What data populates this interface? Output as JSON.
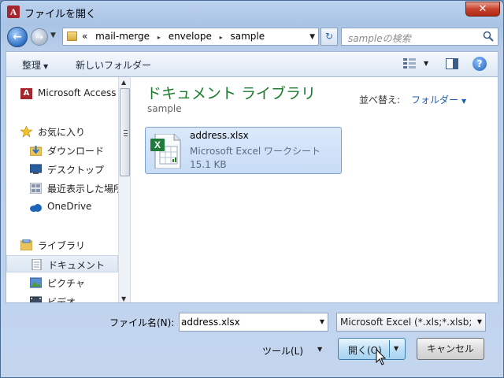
{
  "window": {
    "title": "ファイルを開く",
    "app_icon_letter": "A",
    "close_glyph": "✕"
  },
  "nav": {
    "back_glyph": "←",
    "forward_glyph": "→",
    "address": {
      "prefix": "«",
      "crumbs": [
        "mail-merge",
        "envelope",
        "sample"
      ],
      "separator": "▸"
    },
    "refresh_glyph": "↻",
    "search_placeholder": "sampleの検索"
  },
  "toolbar": {
    "organize": "整理",
    "new_folder": "新しいフォルダー"
  },
  "sidebar": {
    "items": [
      {
        "label": "Microsoft Access",
        "icon": "access-icon"
      },
      {
        "label": "お気に入り",
        "icon": "favorites-star-icon"
      },
      {
        "label": "ダウンロード",
        "icon": "downloads-icon"
      },
      {
        "label": "デスクトップ",
        "icon": "desktop-icon"
      },
      {
        "label": "最近表示した場所",
        "icon": "recent-places-icon"
      },
      {
        "label": "OneDrive",
        "icon": "onedrive-cloud-icon"
      },
      {
        "label": "ライブラリ",
        "icon": "libraries-icon"
      },
      {
        "label": "ドキュメント",
        "icon": "documents-icon",
        "selected": true
      },
      {
        "label": "ピクチャ",
        "icon": "pictures-icon"
      },
      {
        "label": "ビデオ",
        "icon": "videos-icon"
      }
    ]
  },
  "content": {
    "library_title": "ドキュメント ライブラリ",
    "library_subtitle": "sample",
    "sort_label": "並べ替え:",
    "sort_value": "フォルダー",
    "files": [
      {
        "name": "address.xlsx",
        "type": "Microsoft Excel ワークシート",
        "size": "15.1 KB",
        "icon": "excel-file-icon"
      }
    ]
  },
  "bottom": {
    "filename_label": "ファイル名(N):",
    "filename_value": "address.xlsx",
    "filter_value": "Microsoft Excel (*.xls;*.xlsb;",
    "tools_label": "ツール(L)",
    "open_label": "開く(O)",
    "cancel_label": "キャンセル"
  },
  "colors": {
    "library_title": "#1a7c2c",
    "sort_value": "#1b5fb5",
    "close_button": "#c7412c",
    "selection": "#c8dcf6"
  }
}
